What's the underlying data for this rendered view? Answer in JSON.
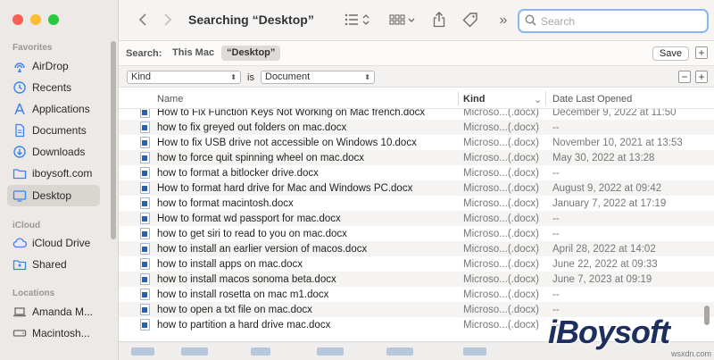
{
  "sidebar": {
    "favorites_title": "Favorites",
    "favorites": [
      {
        "label": "AirDrop",
        "icon": "airdrop-icon"
      },
      {
        "label": "Recents",
        "icon": "clock-icon"
      },
      {
        "label": "Applications",
        "icon": "applications-icon"
      },
      {
        "label": "Documents",
        "icon": "document-icon"
      },
      {
        "label": "Downloads",
        "icon": "download-icon"
      },
      {
        "label": "iboysoft.com",
        "icon": "folder-icon"
      },
      {
        "label": "Desktop",
        "icon": "desktop-icon"
      }
    ],
    "icloud_title": "iCloud",
    "icloud": [
      {
        "label": "iCloud Drive",
        "icon": "cloud-icon"
      },
      {
        "label": "Shared",
        "icon": "shared-folder-icon"
      }
    ],
    "locations_title": "Locations",
    "locations": [
      {
        "label": "Amanda M...",
        "icon": "laptop-icon"
      },
      {
        "label": "Macintosh...",
        "icon": "disk-icon"
      }
    ],
    "selected": "Desktop"
  },
  "toolbar": {
    "title": "Searching “Desktop”",
    "search_placeholder": "Search",
    "more": "»"
  },
  "scope": {
    "label": "Search:",
    "options": [
      "This Mac",
      "“Desktop”"
    ],
    "active": "“Desktop”",
    "save": "Save",
    "minus": "−",
    "plus": "+"
  },
  "criteria": {
    "attribute": "Kind",
    "operator": "is",
    "value": "Document"
  },
  "columns": {
    "name": "Name",
    "kind": "Kind",
    "date": "Date Last Opened"
  },
  "rows": [
    {
      "name": "How to Fix Function Keys Not Working on Mac french.docx",
      "kind": "Microso...(.docx)",
      "date": "December 9, 2022 at 11:50"
    },
    {
      "name": "how to fix greyed out folders on mac.docx",
      "kind": "Microso...(.docx)",
      "date": "--"
    },
    {
      "name": "How to fix USB drive not accessible on Windows 10.docx",
      "kind": "Microso...(.docx)",
      "date": "November 10, 2021 at 13:53"
    },
    {
      "name": "how to force quit spinning wheel on mac.docx",
      "kind": "Microso...(.docx)",
      "date": "May 30, 2022 at 13:28"
    },
    {
      "name": "how to format a bitlocker drive.docx",
      "kind": "Microso...(.docx)",
      "date": "--"
    },
    {
      "name": "How to format hard drive for Mac and Windows PC.docx",
      "kind": "Microso...(.docx)",
      "date": "August 9, 2022 at 09:42"
    },
    {
      "name": "how to format macintosh.docx",
      "kind": "Microso...(.docx)",
      "date": "January 7, 2022 at 17:19"
    },
    {
      "name": "How to format wd passport for mac.docx",
      "kind": "Microso...(.docx)",
      "date": "--"
    },
    {
      "name": "how to get siri to read to you on mac.docx",
      "kind": "Microso...(.docx)",
      "date": "--"
    },
    {
      "name": "how to install an earlier version of macos.docx",
      "kind": "Microso...(.docx)",
      "date": "April 28, 2022 at 14:02"
    },
    {
      "name": "how to install apps on mac.docx",
      "kind": "Microso...(.docx)",
      "date": "June 22, 2022 at 09:33"
    },
    {
      "name": "how to install macos sonoma beta.docx",
      "kind": "Microso...(.docx)",
      "date": "June 7, 2023 at 09:19"
    },
    {
      "name": "how to install rosetta on mac m1.docx",
      "kind": "Microso...(.docx)",
      "date": "--"
    },
    {
      "name": "how to open a txt file on mac.docx",
      "kind": "Microso...(.docx)",
      "date": "--"
    },
    {
      "name": "how to partition a hard drive mac.docx",
      "kind": "Microso...(.docx)",
      "date": "--"
    }
  ],
  "watermark": {
    "brand": "iBoysoft",
    "sub": "wsxdn.com"
  },
  "colors": {
    "accent": "#2f7ff5",
    "close": "#fe5f57",
    "minimize": "#febc2e",
    "zoom": "#28c840",
    "brand": "#1c2f5f"
  }
}
